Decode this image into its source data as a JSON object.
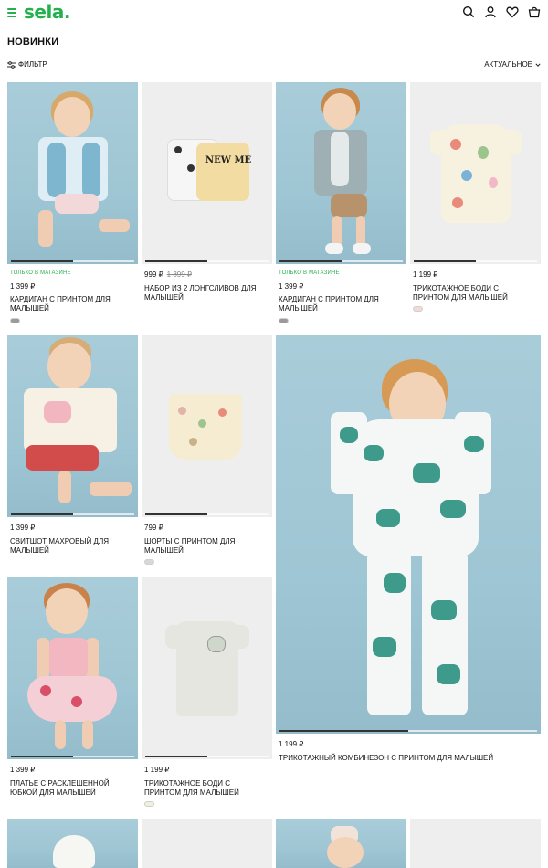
{
  "header": {
    "logo": "sela.",
    "icons": [
      "menu-icon",
      "search-icon",
      "account-icon",
      "heart-icon",
      "bag-icon"
    ],
    "accent": "#22b14c"
  },
  "page": {
    "title": "НОВИНКИ"
  },
  "toolbar": {
    "filter_label": "ФИЛЬТР",
    "sort_label": "АКТУАЛЬНОЕ"
  },
  "products": [
    {
      "badge": "ТОЛЬКО В МАГАЗИНЕ",
      "price": "1 399 ₽",
      "old_price": "",
      "name": "КАРДИГАН С ПРИНТОМ ДЛЯ МАЛЫШЕЙ",
      "swatch": "#9a9a9a"
    },
    {
      "badge": "",
      "price": "999 ₽",
      "old_price": "1 399 ₽",
      "name": "НАБОР ИЗ 2 ЛОНГСЛИВОВ ДЛЯ МАЛЫШЕЙ",
      "swatch": ""
    },
    {
      "badge": "ТОЛЬКО В МАГАЗИНЕ",
      "price": "1 399 ₽",
      "old_price": "",
      "name": "КАРДИГАН С ПРИНТОМ ДЛЯ МАЛЫШЕЙ",
      "swatch": "#9a9a9a"
    },
    {
      "badge": "",
      "price": "1 199 ₽",
      "old_price": "",
      "name": "ТРИКОТАЖНОЕ БОДИ С ПРИНТОМ ДЛЯ МАЛЫШЕЙ",
      "swatch": "#f2dcd2"
    },
    {
      "badge": "",
      "price": "1 399 ₽",
      "old_price": "",
      "name": "СВИТШОТ МАХРОВЫЙ ДЛЯ МАЛЫШЕЙ",
      "swatch": ""
    },
    {
      "badge": "",
      "price": "799 ₽",
      "old_price": "",
      "name": "ШОРТЫ С ПРИНТОМ ДЛЯ МАЛЫШЕЙ",
      "swatch": "#d8d8d8"
    },
    {
      "badge": "",
      "price": "1 199 ₽",
      "old_price": "",
      "name": "ТРИКОТАЖНЫЙ КОМБИНЕЗОН С ПРИНТОМ ДЛЯ МАЛЫШЕЙ",
      "swatch": ""
    },
    {
      "badge": "",
      "price": "1 399 ₽",
      "old_price": "",
      "name": "ПЛАТЬЕ С РАСКЛЕШЕННОЙ ЮБКОЙ ДЛЯ МАЛЫШЕЙ",
      "swatch": ""
    },
    {
      "badge": "",
      "price": "1 199 ₽",
      "old_price": "",
      "name": "ТРИКОТАЖНОЕ БОДИ С ПРИНТОМ ДЛЯ МАЛЫШЕЙ",
      "swatch": "#eef2dc"
    }
  ]
}
